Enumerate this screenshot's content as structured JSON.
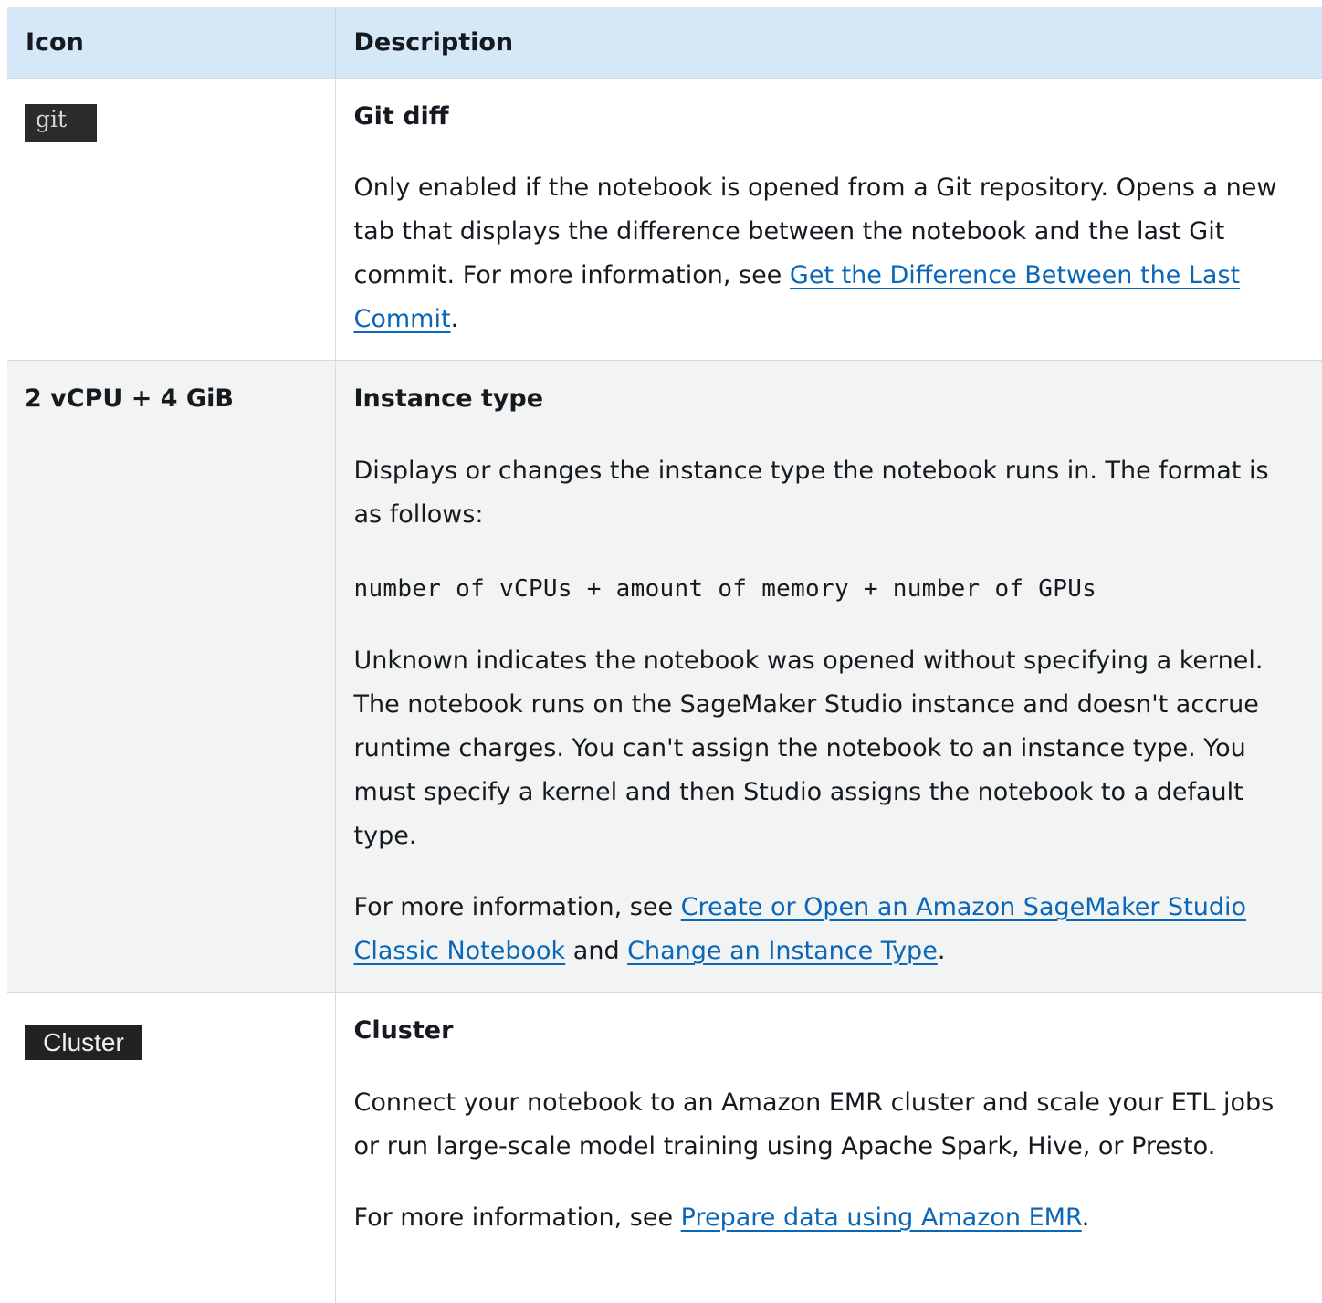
{
  "table": {
    "headers": {
      "icon": "Icon",
      "description": "Description"
    },
    "rows": {
      "git": {
        "icon_text": "git",
        "title": "Git diff",
        "text_before_link": "Only enabled if the notebook is opened from a Git repository. Opens a new tab that displays the difference between the notebook and the last Git commit. For more information, see ",
        "link": "Get the Difference Between the Last Commit",
        "text_after_link": "."
      },
      "instance": {
        "icon_text": "2 vCPU + 4 GiB",
        "title": "Instance type",
        "p1": "Displays or changes the instance type the notebook runs in. The format is as follows:",
        "code": "number of vCPUs + amount of memory + number of GPUs",
        "p2": "Unknown indicates the notebook was opened without specifying a kernel. The notebook runs on the SageMaker Studio instance and doesn't accrue runtime charges. You can't assign the notebook to an instance type. You must specify a kernel and then Studio assigns the notebook to a default type.",
        "p3_before": "For more information, see ",
        "link1": "Create or Open an Amazon SageMaker Studio Classic Notebook",
        "p3_between": " and ",
        "link2": "Change an Instance Type",
        "p3_after": "."
      },
      "cluster": {
        "icon_text": "Cluster",
        "title": "Cluster",
        "p1": "Connect your notebook to an Amazon EMR cluster and scale your ETL jobs or run large-scale model training using Apache Spark, Hive, or Presto.",
        "p2_before": "For more information, see ",
        "link": "Prepare data using Amazon EMR",
        "p2_after": "."
      }
    }
  }
}
